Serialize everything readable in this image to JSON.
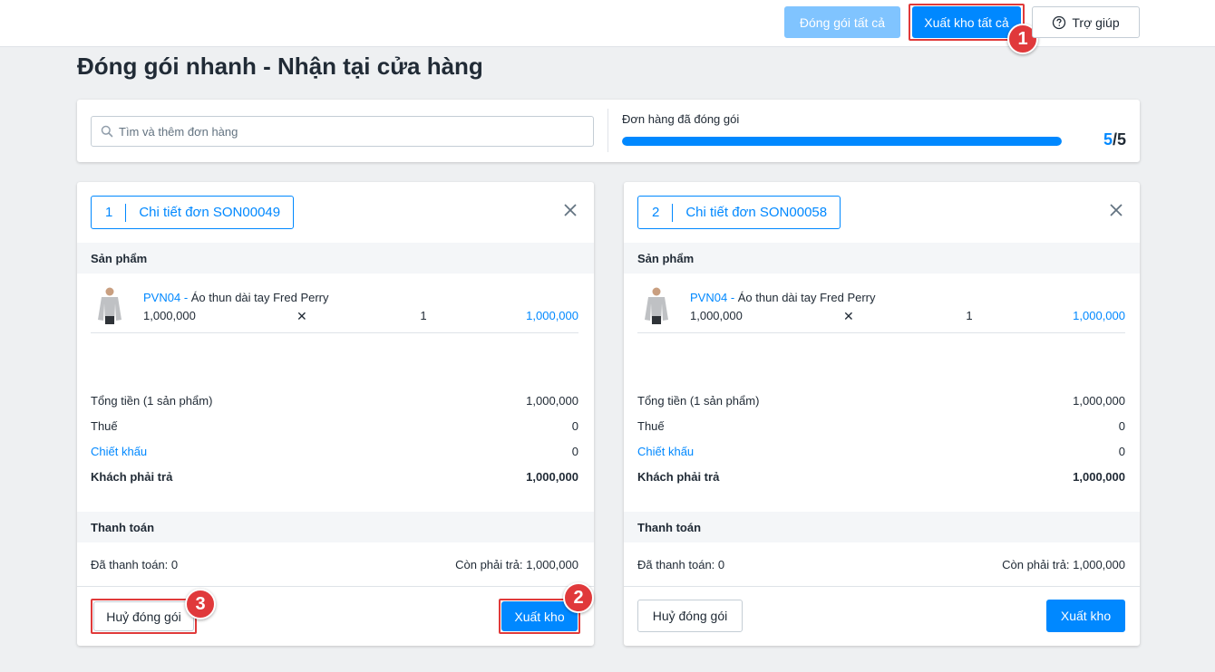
{
  "header": {
    "pack_all_label": "Đóng gói tất cả",
    "export_all_label": "Xuất kho tất cả",
    "help_label": "Trợ giúp"
  },
  "page_title": "Đóng gói nhanh - Nhận tại cửa hàng",
  "search": {
    "placeholder": "Tìm và thêm đơn hàng"
  },
  "progress": {
    "label": "Đơn hàng đã đóng gói",
    "done": "5",
    "total": "/5",
    "fraction": 1.0
  },
  "annotations": [
    "1",
    "2",
    "3"
  ],
  "orders": [
    {
      "index": "1",
      "title": "Chi tiết đơn SON00049",
      "products_heading": "Sản phẩm",
      "product": {
        "sku": "PVN04",
        "separator": " - ",
        "name": "Áo thun dài tay Fred Perry",
        "price": "1,000,000",
        "times": "✕",
        "qty": "1",
        "line_total": "1,000,000"
      },
      "summary": {
        "subtotal_label": "Tổng tiền (1 sản phẩm)",
        "subtotal": "1,000,000",
        "tax_label": "Thuế",
        "tax": "0",
        "discount_label": "Chiết khấu",
        "discount": "0",
        "due_label": "Khách phải trả",
        "due": "1,000,000"
      },
      "payment_heading": "Thanh toán",
      "paid": "Đã thanh toán: 0",
      "remaining": "Còn phải trả: 1,000,000",
      "cancel_label": "Huỷ đóng gói",
      "export_label": "Xuất kho"
    },
    {
      "index": "2",
      "title": "Chi tiết đơn SON00058",
      "products_heading": "Sản phẩm",
      "product": {
        "sku": "PVN04",
        "separator": " - ",
        "name": "Áo thun dài tay Fred Perry",
        "price": "1,000,000",
        "times": "✕",
        "qty": "1",
        "line_total": "1,000,000"
      },
      "summary": {
        "subtotal_label": "Tổng tiền (1 sản phẩm)",
        "subtotal": "1,000,000",
        "tax_label": "Thuế",
        "tax": "0",
        "discount_label": "Chiết khấu",
        "discount": "0",
        "due_label": "Khách phải trả",
        "due": "1,000,000"
      },
      "payment_heading": "Thanh toán",
      "paid": "Đã thanh toán: 0",
      "remaining": "Còn phải trả: 1,000,000",
      "cancel_label": "Huỷ đóng gói",
      "export_label": "Xuất kho"
    }
  ]
}
